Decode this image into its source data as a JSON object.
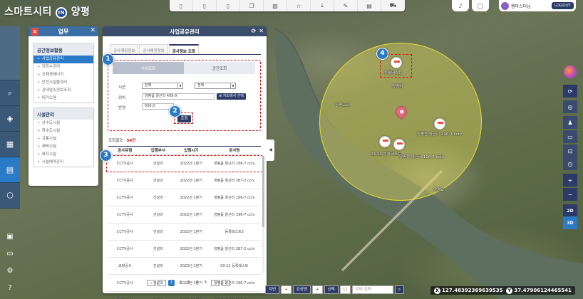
{
  "app": {
    "logo_text": "스마트시티",
    "logo_in": "IN",
    "logo_city": "양평"
  },
  "toolbar": {
    "icons": [
      "doc-icon",
      "doc-icon",
      "doc-icon",
      "copy-icon",
      "image-icon",
      "star-icon",
      "download-icon",
      "edit-icon",
      "book-icon",
      "car-icon"
    ]
  },
  "user": {
    "name": "햄마스터님",
    "logout": "LOGOUT"
  },
  "work_panel": {
    "title": "업무",
    "groups": [
      {
        "title": "공간정보활용",
        "items": [
          "ㄴ 사업공유관리",
          "ㄴ 지하수관리",
          "ㄴ 신재생에너지",
          "ㄴ 안전시설물관리",
          "ㄴ 관내업소정보조회",
          "ㄴ 대기오염"
        ]
      },
      {
        "title": "시설관리",
        "items": [
          "ㄴ 상수도시설",
          "ㄴ 하수도시설",
          "ㄴ 교통시설",
          "ㄴ 체육시설",
          "ㄴ 복지시설",
          "ㄴ 시설예약관리"
        ]
      }
    ]
  },
  "main_panel": {
    "title": "사업공유관리",
    "tabs": [
      "공사계획정보",
      "공사예정정보",
      "공사정보 조회"
    ],
    "segments": [
      "속성조회",
      "공간조회"
    ],
    "form": {
      "sigun_label": "시군",
      "sigun_value": "전체",
      "sigun_value2": "전체",
      "location_label": "위치",
      "location_value": "양평읍 양근리 409-9",
      "map_select": "⊕ 지도에서 선택",
      "radius_label": "반경",
      "radius_value": "500.0",
      "query_button": "조회"
    },
    "result": {
      "label": "조회결과 :",
      "count": "54건"
    },
    "table": {
      "headers": [
        "공사유형",
        "입행부서",
        "입행시기",
        "공사명"
      ],
      "rows": [
        [
          "CCTV공사",
          "건설과",
          "2022년 1분기",
          "양평읍 양근리 196-7 cctv"
        ],
        [
          "CCTV공사",
          "건설과",
          "2022년 1분기",
          "양평읍 양근리 287-2 cctv"
        ],
        [
          "CCTV공사",
          "건설과",
          "2022년 1분기",
          "양평읍 양근리 196-7 cctv"
        ],
        [
          "CCTV공사",
          "건설과",
          "2022년 1분기",
          "양평읍 양근리 196-7 cctv"
        ],
        [
          "CCTV공사",
          "건설과",
          "2022년 1분기",
          "등록테스트3"
        ],
        [
          "CCTV공사",
          "건설과",
          "2022년 1분기",
          "양평읍 양근리 287-2 cctv"
        ],
        [
          "교량공사",
          "건설과",
          "2022년 1분기",
          "03-11 등록테스트"
        ],
        [
          "CCTV공사",
          "건설과",
          "2022년 1분기",
          "양평읍 양근리 196-7 cctv"
        ],
        [
          "CCTV공사",
          "건설과",
          "2022년 1분기",
          "양평읍 양근리 196-7 cctv"
        ]
      ]
    },
    "pager": [
      "«",
      "‹",
      "1",
      "2",
      "3",
      "4",
      "5",
      "›",
      "»"
    ]
  },
  "badges": [
    "1",
    "2",
    "3",
    "4"
  ],
  "map": {
    "labels": [
      "등록테스트",
      "양평역",
      "양평고교",
      "양평읍 양근리 196-7 cctv",
      "03-11 등록테스트",
      "양평읍 양근리 196-7 cctv",
      "양평교"
    ]
  },
  "right_tools": [
    "⟳",
    "◎",
    "♟",
    "▭",
    "⊡",
    "◷",
    "+",
    "−",
    "2D",
    "3D"
  ],
  "bottom_bar": {
    "jijeok": "지번",
    "rail": "강성엔",
    "select": "선택",
    "search_placeholder": "지번 입력"
  },
  "coords": {
    "x_label": "X",
    "x": "127.48392369639535",
    "y_label": "Y",
    "y": "37.47906124465541"
  },
  "colors": {
    "accent": "#2a7ac7",
    "header": "#3b4d6b",
    "highlight": "#d21b1b",
    "radius_fill": "#f0e65a"
  }
}
